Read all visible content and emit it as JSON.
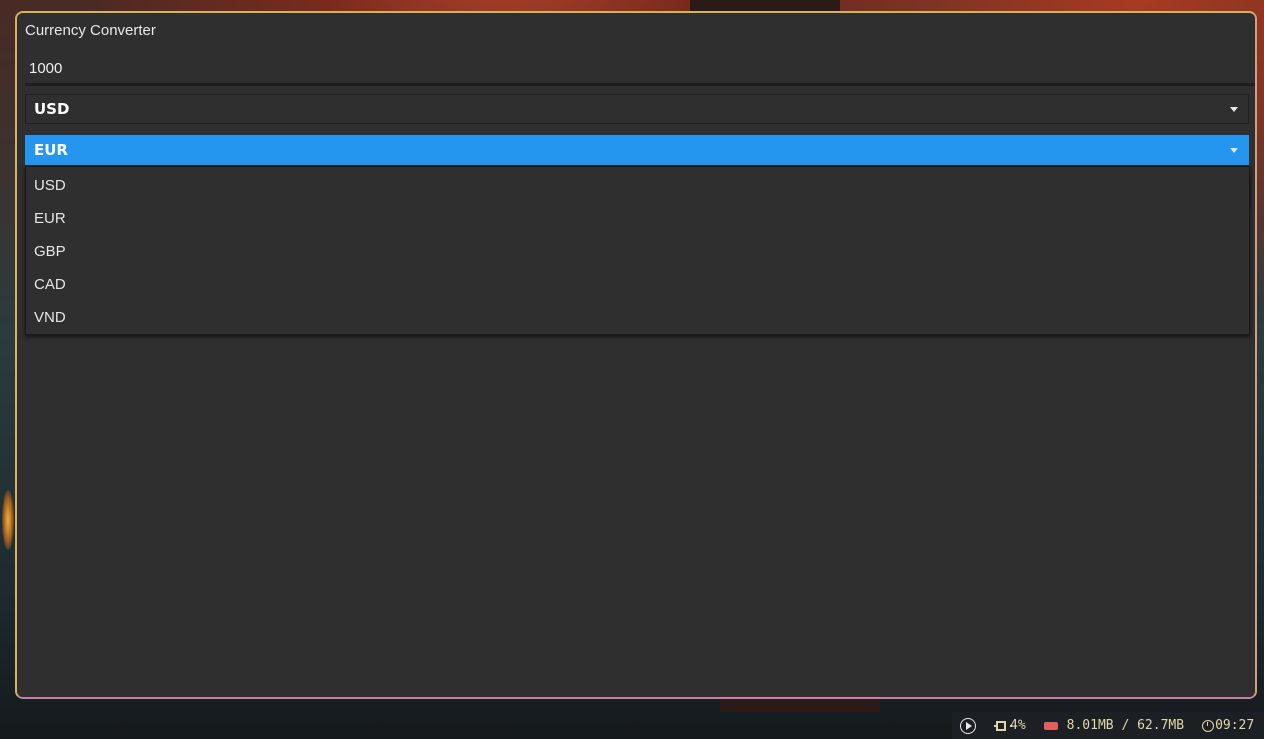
{
  "window": {
    "title": "Currency Converter"
  },
  "converter": {
    "amount_value": "1000",
    "from_currency": "USD",
    "to_currency": "EUR"
  },
  "dropdown": {
    "options": [
      "USD",
      "EUR",
      "GBP",
      "CAD",
      "VND"
    ]
  },
  "taskbar": {
    "cpu": "4%",
    "memory": "8.01MB / 62.7MB",
    "clock": "09:27"
  },
  "colors": {
    "accent": "#2596f0",
    "window_bg": "#2f2f2f",
    "border_top": "#d4b35e",
    "border_bottom": "#c580a8",
    "memory_icon": "#e06060",
    "tray_text": "#e3d6a8"
  },
  "icons": {
    "media": "play-circle-icon",
    "cpu": "cpu-chip-icon",
    "memory": "memory-icon",
    "clock": "clock-icon",
    "dropdown": "chevron-down-icon"
  }
}
